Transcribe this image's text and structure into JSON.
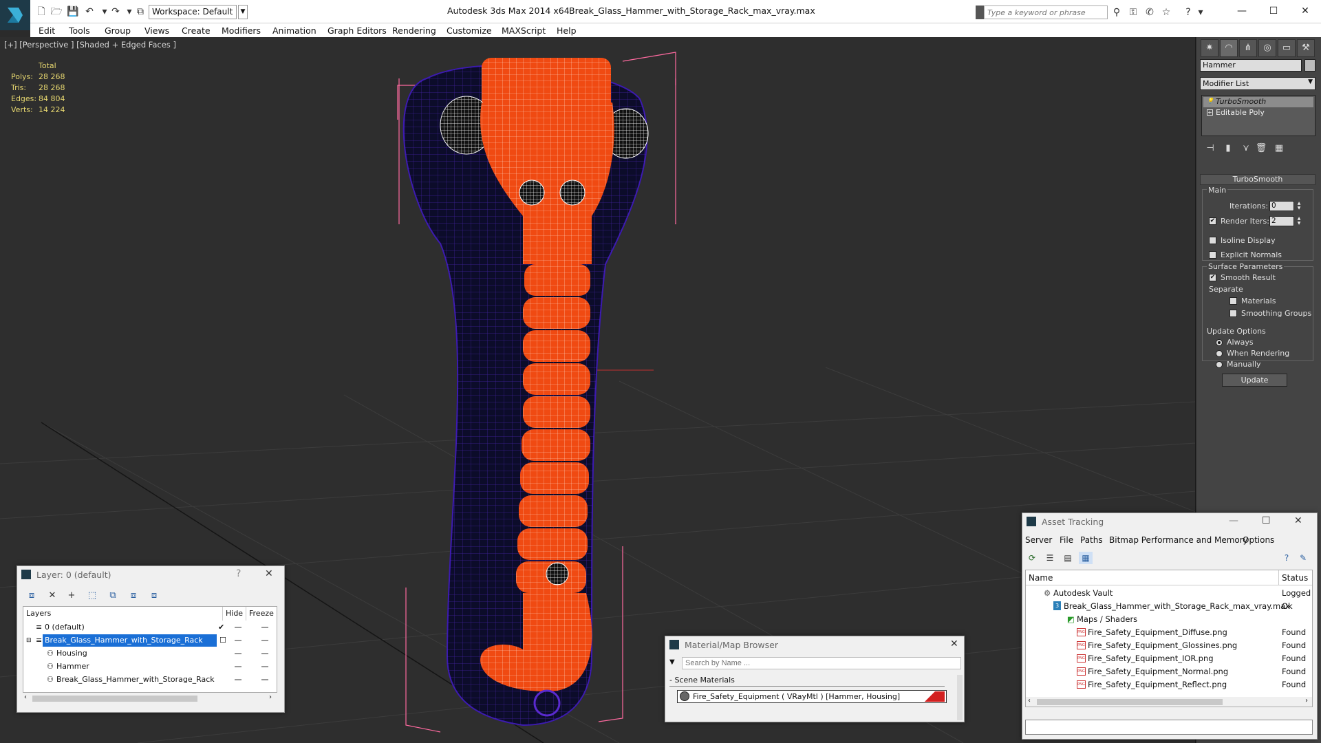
{
  "title_bar": {
    "workspace": "Workspace: Default",
    "app_title": "Autodesk 3ds Max  2014 x64",
    "file_title": "Break_Glass_Hammer_with_Storage_Rack_max_vray.max",
    "search_placeholder": "Type a keyword or phrase",
    "window_controls": [
      "—",
      "☐",
      "✕"
    ]
  },
  "menu": [
    "Edit",
    "Tools",
    "Group",
    "Views",
    "Create",
    "Modifiers",
    "Animation",
    "Graph Editors",
    "Rendering",
    "Customize",
    "MAXScript",
    "Help"
  ],
  "viewport": {
    "label": "[+] [Perspective ] [Shaded + Edged Faces ]",
    "stats_header": "Total",
    "stats": [
      {
        "label": "Polys:",
        "value": "28 268"
      },
      {
        "label": "Tris:",
        "value": "28 268"
      },
      {
        "label": "Edges:",
        "value": "84 804"
      },
      {
        "label": "Verts:",
        "value": "14 224"
      }
    ]
  },
  "command_panel": {
    "object_name": "Hammer",
    "modifier_list": "Modifier List",
    "stack": [
      "TurboSmooth",
      "Editable Poly"
    ],
    "turbosmooth": {
      "title": "TurboSmooth",
      "main": "Main",
      "iterations_label": "Iterations:",
      "iterations_value": "0",
      "render_iters_label": "Render Iters:",
      "render_iters_value": "2",
      "isoline": "Isoline Display",
      "explicit_normals": "Explicit Normals",
      "surface_params": "Surface Parameters",
      "smooth_result": "Smooth Result",
      "separate": "Separate",
      "materials": "Materials",
      "smoothing_groups": "Smoothing Groups",
      "update_options": "Update Options",
      "always": "Always",
      "when_rendering": "When Rendering",
      "manually": "Manually",
      "update_button": "Update"
    }
  },
  "layer_window": {
    "title": "Layer: 0 (default)",
    "help": "?",
    "close": "✕",
    "columns": [
      "Layers",
      "Hide",
      "Freeze"
    ],
    "rows": [
      {
        "name": "0 (default)",
        "indent": 1,
        "selected": false,
        "check": "✔"
      },
      {
        "name": "Break_Glass_Hammer_with_Storage_Rack",
        "indent": 1,
        "selected": true,
        "check": "☐"
      },
      {
        "name": "Housing",
        "indent": 2,
        "selected": false,
        "check": ""
      },
      {
        "name": "Hammer",
        "indent": 2,
        "selected": false,
        "check": ""
      },
      {
        "name": "Break_Glass_Hammer_with_Storage_Rack",
        "indent": 2,
        "selected": false,
        "check": ""
      }
    ]
  },
  "material_browser": {
    "title": "Material/Map Browser",
    "close": "✕",
    "search_placeholder": "Search by Name ...",
    "section": "- Scene Materials",
    "item": "Fire_Safety_Equipment  ( VRayMtl ) [Hammer, Housing]"
  },
  "asset_tracking": {
    "title": "Asset Tracking",
    "menu": [
      "Server",
      "File",
      "Paths",
      "Bitmap Performance and Memory",
      "Options"
    ],
    "columns": [
      "Name",
      "Status"
    ],
    "rows": [
      {
        "name": "Autodesk Vault",
        "status": "Logged",
        "indent": 1,
        "kind": "vault"
      },
      {
        "name": "Break_Glass_Hammer_with_Storage_Rack_max_vray.max",
        "status": "Ok",
        "indent": 2,
        "kind": "max"
      },
      {
        "name": "Maps / Shaders",
        "status": "",
        "indent": 3,
        "kind": "folder"
      },
      {
        "name": "Fire_Safety_Equipment_Diffuse.png",
        "status": "Found",
        "indent": 4,
        "kind": "png"
      },
      {
        "name": "Fire_Safety_Equipment_Glossines.png",
        "status": "Found",
        "indent": 4,
        "kind": "png"
      },
      {
        "name": "Fire_Safety_Equipment_IOR.png",
        "status": "Found",
        "indent": 4,
        "kind": "png"
      },
      {
        "name": "Fire_Safety_Equipment_Normal.png",
        "status": "Found",
        "indent": 4,
        "kind": "png"
      },
      {
        "name": "Fire_Safety_Equipment_Reflect.png",
        "status": "Found",
        "indent": 4,
        "kind": "png"
      }
    ]
  },
  "colors": {
    "hammer_orange": "#f04a12",
    "housing_navy": "#0c0c2a",
    "wire_purple": "#5a2ad0",
    "bbox_pink": "#ff6aa0",
    "selection_blue": "#1a6fd6"
  }
}
